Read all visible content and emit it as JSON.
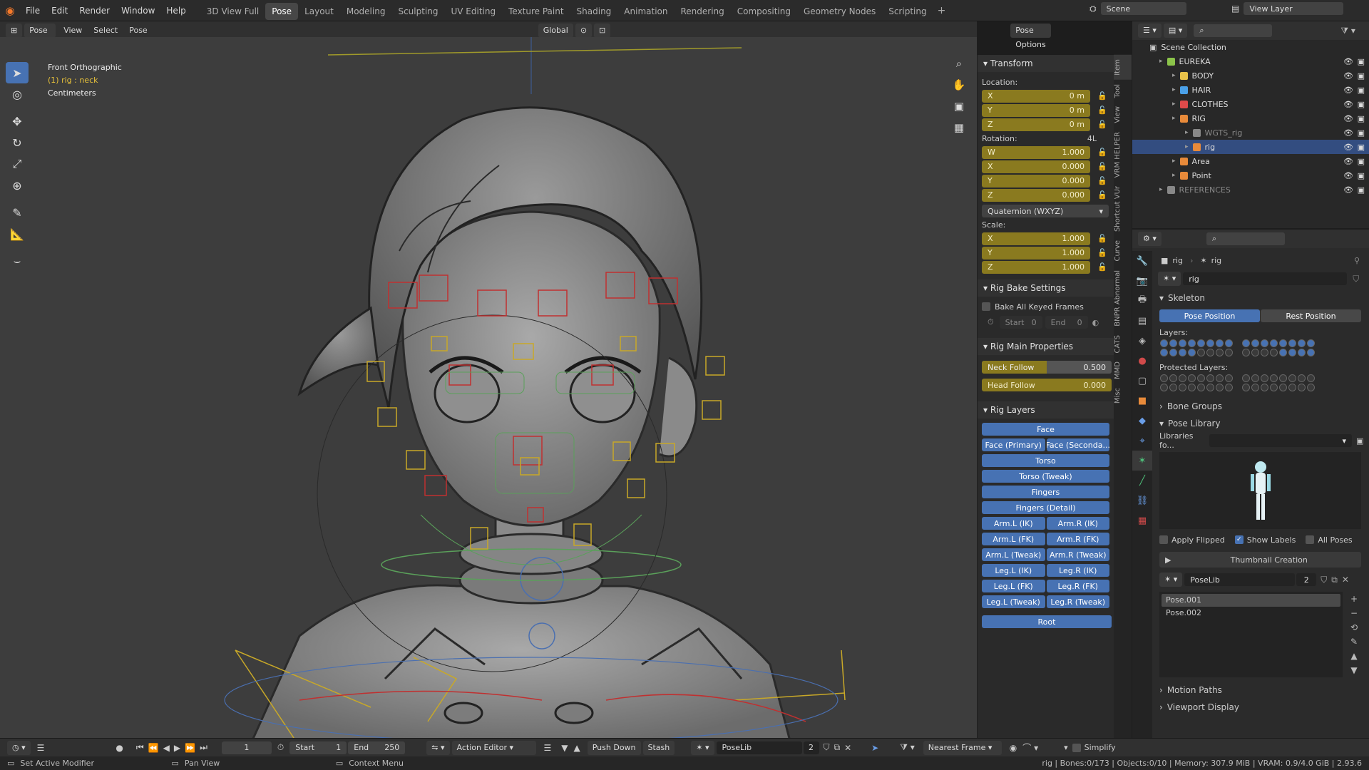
{
  "topbar": {
    "menus": [
      "File",
      "Edit",
      "Render",
      "Window",
      "Help"
    ],
    "workspaces": [
      "3D View Full",
      "Pose",
      "Layout",
      "Modeling",
      "Sculpting",
      "UV Editing",
      "Texture Paint",
      "Shading",
      "Animation",
      "Rendering",
      "Compositing",
      "Geometry Nodes",
      "Scripting"
    ],
    "active_workspace": "Pose",
    "scene": "Scene",
    "view_layer": "View Layer"
  },
  "viewport_header": {
    "mode": "Pose Mode",
    "menus": [
      "View",
      "Select",
      "Pose"
    ],
    "transform_orientation": "Global",
    "pose_options": "Pose Options"
  },
  "viewport_overlay": {
    "view_name": "Front Orthographic",
    "active": "(1) rig : neck",
    "units": "Centimeters"
  },
  "transform_panel": {
    "title": "Transform",
    "location_label": "Location:",
    "location": [
      {
        "axis": "X",
        "value": "0 m"
      },
      {
        "axis": "Y",
        "value": "0 m"
      },
      {
        "axis": "Z",
        "value": "0 m"
      }
    ],
    "rotation_label": "Rotation:",
    "rotation_mode_short": "4L",
    "rotation": [
      {
        "axis": "W",
        "value": "1.000"
      },
      {
        "axis": "X",
        "value": "0.000"
      },
      {
        "axis": "Y",
        "value": "0.000"
      },
      {
        "axis": "Z",
        "value": "0.000"
      }
    ],
    "rotation_mode": "Quaternion (WXYZ)",
    "scale_label": "Scale:",
    "scale": [
      {
        "axis": "X",
        "value": "1.000"
      },
      {
        "axis": "Y",
        "value": "1.000"
      },
      {
        "axis": "Z",
        "value": "1.000"
      }
    ]
  },
  "rig_bake": {
    "title": "Rig Bake Settings",
    "bake_all": "Bake All Keyed Frames",
    "start_label": "Start",
    "start": "0",
    "end_label": "End",
    "end": "0"
  },
  "rig_main": {
    "title": "Rig Main Properties",
    "neck_follow_label": "Neck Follow",
    "neck_follow": "0.500",
    "neck_follow_fraction": 0.5,
    "head_follow_label": "Head Follow",
    "head_follow": "0.000"
  },
  "rig_layers": {
    "title": "Rig Layers",
    "rows": [
      [
        "Face"
      ],
      [
        "Face (Primary)",
        "Face (Seconda..."
      ],
      [
        "Torso"
      ],
      [
        "Torso (Tweak)"
      ],
      [
        "Fingers"
      ],
      [
        "Fingers (Detail)"
      ],
      [
        "Arm.L (IK)",
        "Arm.R (IK)"
      ],
      [
        "Arm.L (FK)",
        "Arm.R (FK)"
      ],
      [
        "Arm.L (Tweak)",
        "Arm.R (Tweak)"
      ],
      [
        "Leg.L (IK)",
        "Leg.R (IK)"
      ],
      [
        "Leg.L (FK)",
        "Leg.R (FK)"
      ],
      [
        "Leg.L (Tweak)",
        "Leg.R (Tweak)"
      ]
    ],
    "root": "Root"
  },
  "side_tabs": [
    "Item",
    "Tool",
    "View",
    "VRM HELPER",
    "Shortcut VUr",
    "Curve",
    "BNPR Abnormal",
    "CATS",
    "MMD",
    "Misc"
  ],
  "outliner": {
    "root": "Scene Collection",
    "items": [
      {
        "name": "EUREKA",
        "depth": 0,
        "color": "#8bc34a"
      },
      {
        "name": "BODY",
        "depth": 1,
        "color": "#e8c24a"
      },
      {
        "name": "HAIR",
        "depth": 1,
        "color": "#4aa0e8"
      },
      {
        "name": "CLOTHES",
        "depth": 1,
        "color": "#e04a4a"
      },
      {
        "name": "RIG",
        "depth": 1,
        "color": "#e88a3a"
      },
      {
        "name": "WGTS_rig",
        "depth": 2,
        "color": "#888888"
      },
      {
        "name": "rig",
        "depth": 2,
        "color": "#e88a3a",
        "selected": true
      },
      {
        "name": "Area",
        "depth": 1,
        "color": "#e88a3a"
      },
      {
        "name": "Point",
        "depth": 1,
        "color": "#e88a3a"
      },
      {
        "name": "REFERENCES",
        "depth": 0,
        "color": "#888888"
      }
    ]
  },
  "properties": {
    "breadcrumb_object": "rig",
    "breadcrumb_data": "rig",
    "datablock": "rig",
    "skeleton_title": "Skeleton",
    "pose_position": "Pose Position",
    "rest_position": "Rest Position",
    "layers_label": "Layers:",
    "protected_layers_label": "Protected Layers:",
    "bone_groups": "Bone Groups",
    "pose_library": "Pose Library",
    "libraries_label": "Libraries fo...",
    "apply_flipped": "Apply Flipped",
    "show_labels": "Show Labels",
    "all_poses": "All Poses",
    "thumbnail_creation": "Thumbnail Creation",
    "poselib_name": "PoseLib",
    "poselib_users": "2",
    "poses": [
      "Pose.001",
      "Pose.002"
    ],
    "motion_paths": "Motion Paths",
    "viewport_display": "Viewport Display"
  },
  "timeline": {
    "current_frame": "1",
    "start_label": "Start",
    "start": "1",
    "end_label": "End",
    "end": "250",
    "editor": "Action Editor",
    "push_down": "Push Down",
    "stash": "Stash",
    "action": "PoseLib",
    "action_users": "2",
    "snapping": "Nearest Frame",
    "simplify": "Simplify"
  },
  "statusbar": {
    "left": "Set Active Modifier",
    "middle": "Pan View",
    "right_ctx": "Context Menu",
    "stats": "rig | Bones:0/173 | Objects:0/10 | Memory: 307.9 MiB | VRAM: 0.9/4.0 GiB | 2.93.6"
  },
  "colors": {
    "accent": "#4772b3",
    "field_yellow": "#8a7a1f",
    "bg": "#3d3d3d"
  }
}
